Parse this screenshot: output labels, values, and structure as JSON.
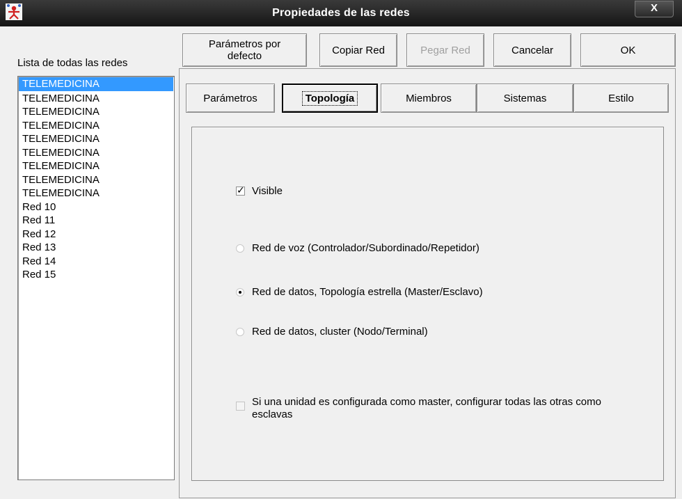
{
  "window": {
    "title": "Propiedades de las redes",
    "close_label": "X",
    "icon": "network-app-icon"
  },
  "list": {
    "label": "Lista de todas las redes",
    "items": [
      "TELEMEDICINA",
      "TELEMEDICINA",
      "TELEMEDICINA",
      "TELEMEDICINA",
      "TELEMEDICINA",
      "TELEMEDICINA",
      "TELEMEDICINA",
      "TELEMEDICINA",
      "TELEMEDICINA",
      "Red 10",
      "Red 11",
      "Red 12",
      "Red 13",
      "Red 14",
      "Red 15"
    ],
    "selected_index": 0
  },
  "toolbar": {
    "defaults_label": "Parámetros por defecto",
    "copy_label": "Copiar Red",
    "paste_label": "Pegar Red",
    "cancel_label": "Cancelar",
    "ok_label": "OK"
  },
  "tabs": [
    {
      "label": "Parámetros"
    },
    {
      "label": "Topología"
    },
    {
      "label": "Miembros"
    },
    {
      "label": "Sistemas"
    },
    {
      "label": "Estilo"
    }
  ],
  "active_tab": "Topología",
  "topology": {
    "visible_label": "Visible",
    "visible_checked": true,
    "radio_voice": "Red de voz (Controlador/Subordinado/Repetidor)",
    "radio_star": "Red de datos, Topología estrella (Master/Esclavo)",
    "radio_cluster": "Red de datos, cluster (Nodo/Terminal)",
    "selected_radio": "star",
    "master_slave_label": "Si una unidad es configurada como master, configurar todas las otras como esclavas",
    "master_slave_checked": false,
    "master_slave_enabled": false
  },
  "colors": {
    "selection": "#3399ff",
    "titlebar": "#151515",
    "background": "#f0f0f0"
  }
}
